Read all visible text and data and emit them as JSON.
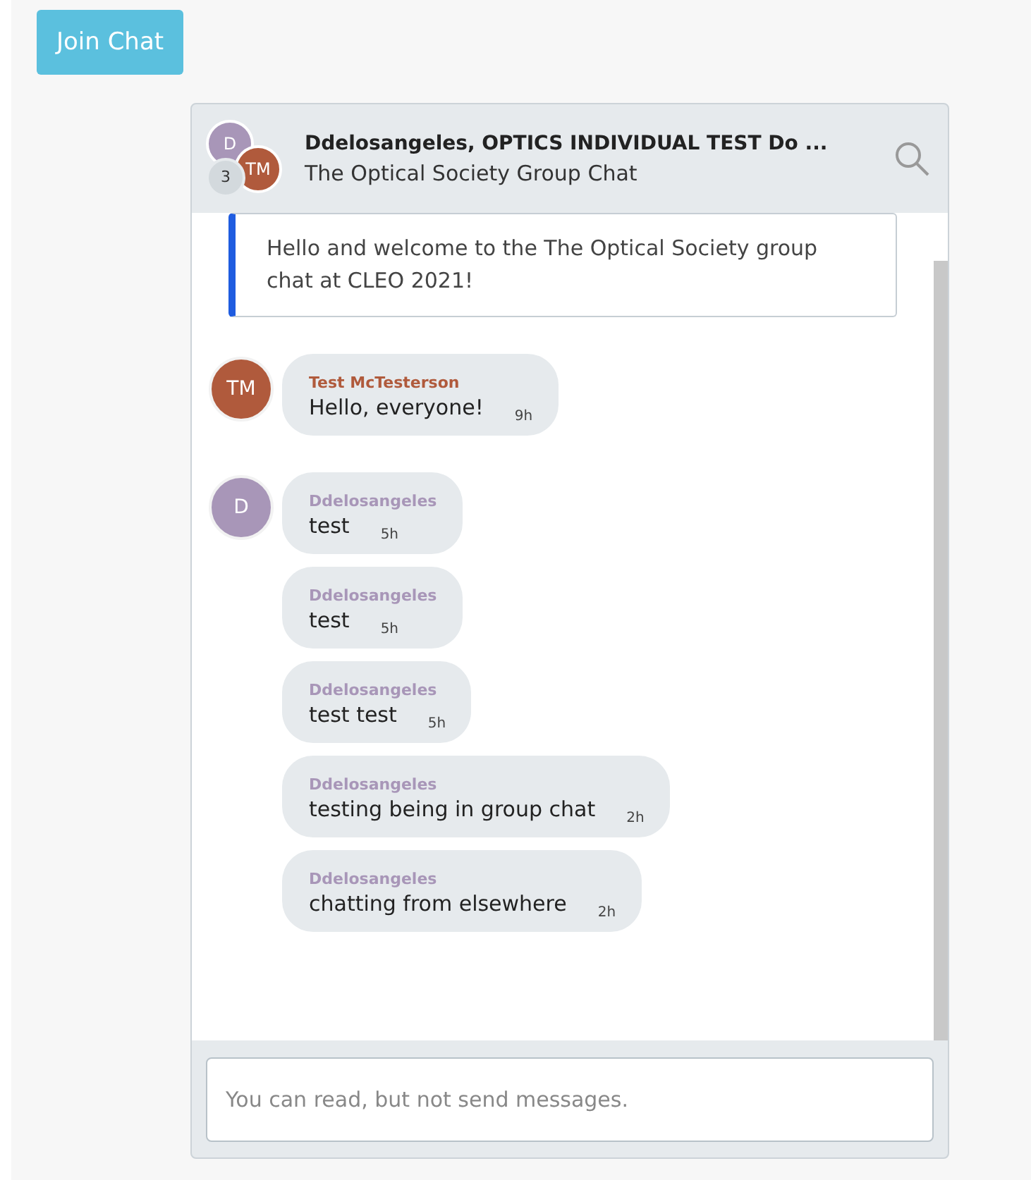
{
  "join_button": "Join Chat",
  "chat": {
    "title": "Ddelosangeles, OPTICS INDIVIDUAL TEST Do ...",
    "subtitle": "The Optical Society Group Chat",
    "participants": [
      {
        "initials": "D",
        "color": "#a896b8"
      },
      {
        "initials": "TM",
        "color": "#b05a3c"
      }
    ],
    "extra_count": "3",
    "welcome": "Hello and welcome to the The Optical Society group chat at CLEO 2021!",
    "groups": [
      {
        "initials": "TM",
        "color": "#b05a3c",
        "messages": [
          {
            "author": "Test McTesterson",
            "text": "Hello, everyone!",
            "time": "9h"
          }
        ]
      },
      {
        "initials": "D",
        "color": "#a896b8",
        "messages": [
          {
            "author": "Ddelosangeles",
            "text": "test",
            "time": "5h"
          },
          {
            "author": "Ddelosangeles",
            "text": "test",
            "time": "5h"
          },
          {
            "author": "Ddelosangeles",
            "text": "test test",
            "time": "5h"
          },
          {
            "author": "Ddelosangeles",
            "text": "testing being in group chat",
            "time": "2h"
          },
          {
            "author": "Ddelosangeles",
            "text": "chatting from elsewhere",
            "time": "2h"
          }
        ]
      }
    ],
    "input": {
      "placeholder": "You can read, but not send messages."
    }
  }
}
